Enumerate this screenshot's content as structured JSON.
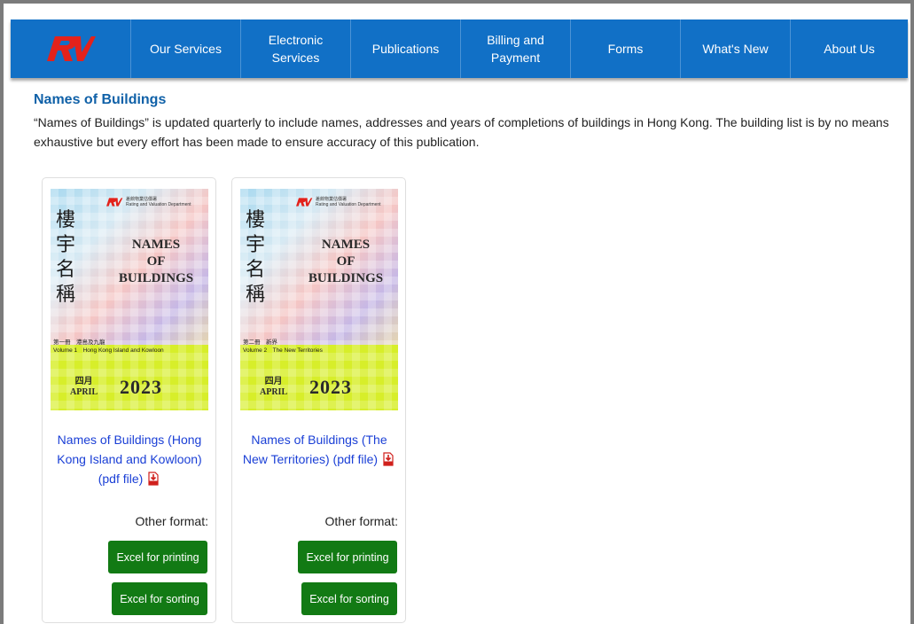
{
  "nav": {
    "logo_alt": "RV",
    "items": [
      {
        "label": "Our Services"
      },
      {
        "label": "Electronic Services"
      },
      {
        "label": "Publications"
      },
      {
        "label": "Billing and Payment"
      },
      {
        "label": "Forms"
      },
      {
        "label": "What's New"
      },
      {
        "label": "About Us"
      }
    ]
  },
  "page": {
    "title": "Names of Buildings",
    "intro": "“Names of Buildings” is updated quarterly to include names, addresses and years of completions of buildings in Hong Kong. The building list is by no means exhaustive but every effort has been made to ensure accuracy of this publication."
  },
  "cards": [
    {
      "cover": {
        "dept_cn": "差餉物業估價署",
        "dept_en": "Rating and Valuation Department",
        "chinese_title": "樓宇名稱",
        "english_title_1": "NAMES",
        "english_title_2": "OF",
        "english_title_3": "BUILDINGS",
        "volume_cn": "第一冊　港島及九龍",
        "volume_en": "Volume 1　Hong Kong Island and Kowloon",
        "month_cn": "四月",
        "month_en": "APRIL",
        "year": "2023"
      },
      "link_text": "Names of Buildings (Hong Kong Island and Kowloon) (pdf file)",
      "other_format": "Other format:",
      "btn_print": "Excel for printing",
      "btn_sort": "Excel for sorting"
    },
    {
      "cover": {
        "dept_cn": "差餉物業估價署",
        "dept_en": "Rating and Valuation Department",
        "chinese_title": "樓宇名稱",
        "english_title_1": "NAMES",
        "english_title_2": "OF",
        "english_title_3": "BUILDINGS",
        "volume_cn": "第二冊　新界",
        "volume_en": "Volume 2　The New Territories",
        "month_cn": "四月",
        "month_en": "APRIL",
        "year": "2023"
      },
      "link_text": "Names of Buildings (The New Territories) (pdf file)",
      "other_format": "Other format:",
      "btn_print": "Excel for printing",
      "btn_sort": "Excel for sorting"
    }
  ],
  "colors": {
    "nav_bg": "#1170c6",
    "title": "#1061a8",
    "link": "#1a3fd6",
    "button": "#127a14",
    "logo_red": "#e3221b",
    "pdf_red": "#d0201c"
  },
  "icons": {
    "logo": "rv-logo",
    "pdf": "pdf-download-icon"
  }
}
